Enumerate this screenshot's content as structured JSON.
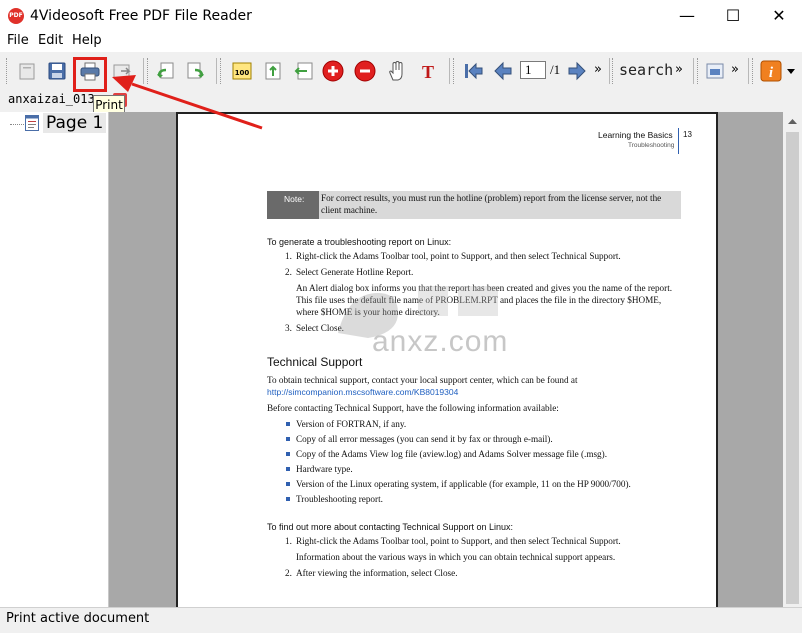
{
  "window": {
    "title": "4Videosoft Free PDF File Reader",
    "app_icon_text": "PDF",
    "minimize": "—",
    "maximize": "☐",
    "close": "✕"
  },
  "menu": [
    "File",
    "Edit",
    "Help"
  ],
  "toolbar": {
    "page_current": "1",
    "page_total": "/1",
    "search_label": "search",
    "more": "»"
  },
  "tab": {
    "label": "anxaizai_013."
  },
  "tooltip": "Print",
  "sidebar": {
    "page_node": "Page 1"
  },
  "document": {
    "running_head": "Learning the Basics",
    "running_subhead": "Troubleshooting",
    "page_number": "13",
    "note_label": "Note:",
    "note_text_1": "For correct results, you must run the hotline (problem) report from the license server, not the",
    "note_text_2": "client machine.",
    "linux_intro": "To generate a troubleshooting report on Linux:",
    "step1": "Right-click the Adams Toolbar tool, point to Support, and then select Technical Support.",
    "step2": "Select Generate Hotline Report.",
    "step2_desc_1": "An Alert dialog box informs you that the report has been created and gives you the name of the report.",
    "step2_desc_2": "This file uses the default file name of PROBLEM.RPT and places the file in the directory $HOME,",
    "step2_desc_3": "where $HOME is your home directory.",
    "step3": "Select Close.",
    "tech_heading": "Technical Support",
    "tech_p1": "To obtain technical support, contact your local support center, which can be found at",
    "tech_link": "http://simcompanion.mscsoftware.com/KB8019304",
    "tech_p2": "Before contacting Technical Support, have the following information available:",
    "bullets": [
      "Version of FORTRAN, if any.",
      "Copy of all error messages (you can send it by fax or through e-mail).",
      "Copy of the Adams View log file (aview.log) and Adams Solver message file (.msg).",
      "Hardware type.",
      "Version of the Linux operating system, if applicable (for example, 11 on the HP 9000/700).",
      "Troubleshooting report."
    ],
    "more_intro": "To find out more about contacting Technical Support on Linux:",
    "more_step1": "Right-click the Adams Toolbar tool, point to Support, and then select Technical Support.",
    "more_step1_desc": "Information about the various ways in which you can obtain technical support appears.",
    "more_step2": "After viewing the information, select Close."
  },
  "watermark": "anxz.com",
  "status": "Print active document",
  "colors": {
    "highlight": "#e0201a",
    "accent_red": "#e0312a",
    "note_bg": "#d9d9d9",
    "note_label_bg": "#6a6a6a",
    "link": "#2060c0"
  }
}
